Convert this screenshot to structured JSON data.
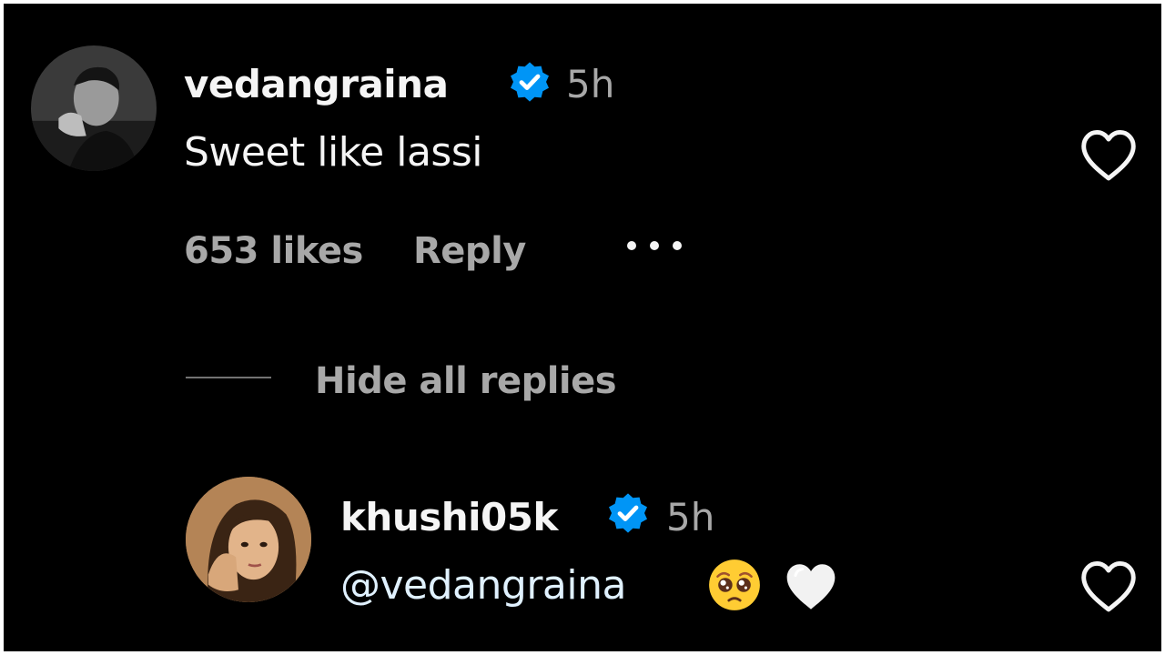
{
  "comment": {
    "username": "vedangraina",
    "time": "5h",
    "text": "Sweet like lassi",
    "likes": "653 likes",
    "reply_label": "Reply"
  },
  "replies_toggle": "Hide all replies",
  "reply": {
    "username": "khushi05k",
    "time": "5h",
    "mention": "@vedangraina"
  },
  "colors": {
    "background": "#000000",
    "verified_badge": "#0095f6",
    "secondary_text": "#a8a8a8",
    "primary_text": "#f5f5f5"
  },
  "icons": [
    "verified-badge-icon",
    "heart-outline-icon",
    "more-options-icon",
    "pleading-face-emoji",
    "white-heart-emoji"
  ]
}
